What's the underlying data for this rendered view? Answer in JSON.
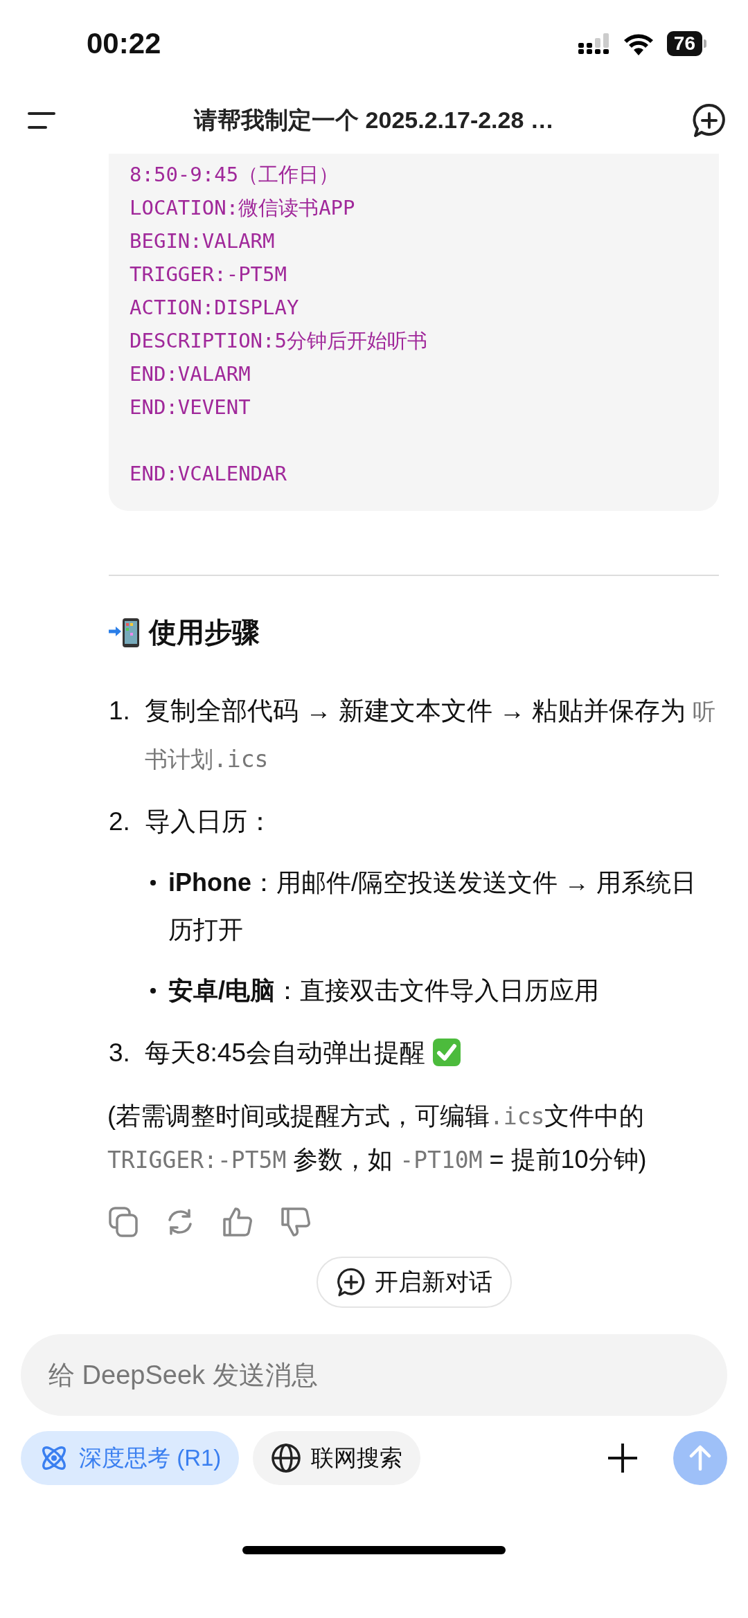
{
  "status_bar": {
    "time": "00:22",
    "battery": "76"
  },
  "header": {
    "title": "请帮我制定一个 2025.2.17-2.28 …"
  },
  "code_block": {
    "paragraphs": [
      [
        "8:50-9:45（工作日）",
        "LOCATION:微信读书APP",
        "BEGIN:VALARM",
        "TRIGGER:-PT5M",
        "ACTION:DISPLAY",
        "DESCRIPTION:5分钟后开始听书",
        "END:VALARM",
        "END:VEVENT"
      ],
      [
        "END:VCALENDAR"
      ]
    ]
  },
  "section": {
    "heading": "使用步骤"
  },
  "steps": [
    {
      "number": "1.",
      "segments": [
        {
          "kind": "text",
          "text": "复制全部代码 → 新建文本文件 → 粘贴并保存为 "
        },
        {
          "kind": "code",
          "text": "听书计划.ics"
        }
      ],
      "check": false
    },
    {
      "number": "2.",
      "segments": [
        {
          "kind": "text",
          "text": "导入日历："
        }
      ],
      "bullets": [
        "**iPhone**：用邮件/隔空投送发送文件 → 用系统日历打开",
        "**安卓/电脑**：直接双击文件导入日历应用"
      ],
      "check": false
    },
    {
      "number": "3.",
      "segments": [
        {
          "kind": "text",
          "text": "每天8:45会自动弹出提醒"
        }
      ],
      "check": true
    }
  ],
  "note": {
    "segments": [
      {
        "kind": "text",
        "text": "(若需调整时间或提醒方式，可编辑"
      },
      {
        "kind": "code",
        "text": ".ics"
      },
      {
        "kind": "text",
        "text": "文件中的 "
      },
      {
        "kind": "code",
        "text": "TRIGGER:-PT5M"
      },
      {
        "kind": "text",
        "text": " 参数，如 "
      },
      {
        "kind": "code",
        "text": "-PT10M"
      },
      {
        "kind": "text",
        "text": " = 提前10分钟)"
      }
    ]
  },
  "new_chat_button": {
    "label": "开启新对话"
  },
  "composer": {
    "placeholder": "给 DeepSeek 发送消息"
  },
  "toggles": [
    {
      "label": "深度思考 (R1)",
      "selected": true,
      "kind": "think"
    },
    {
      "label": "联网搜索",
      "selected": false,
      "kind": "web"
    }
  ]
}
